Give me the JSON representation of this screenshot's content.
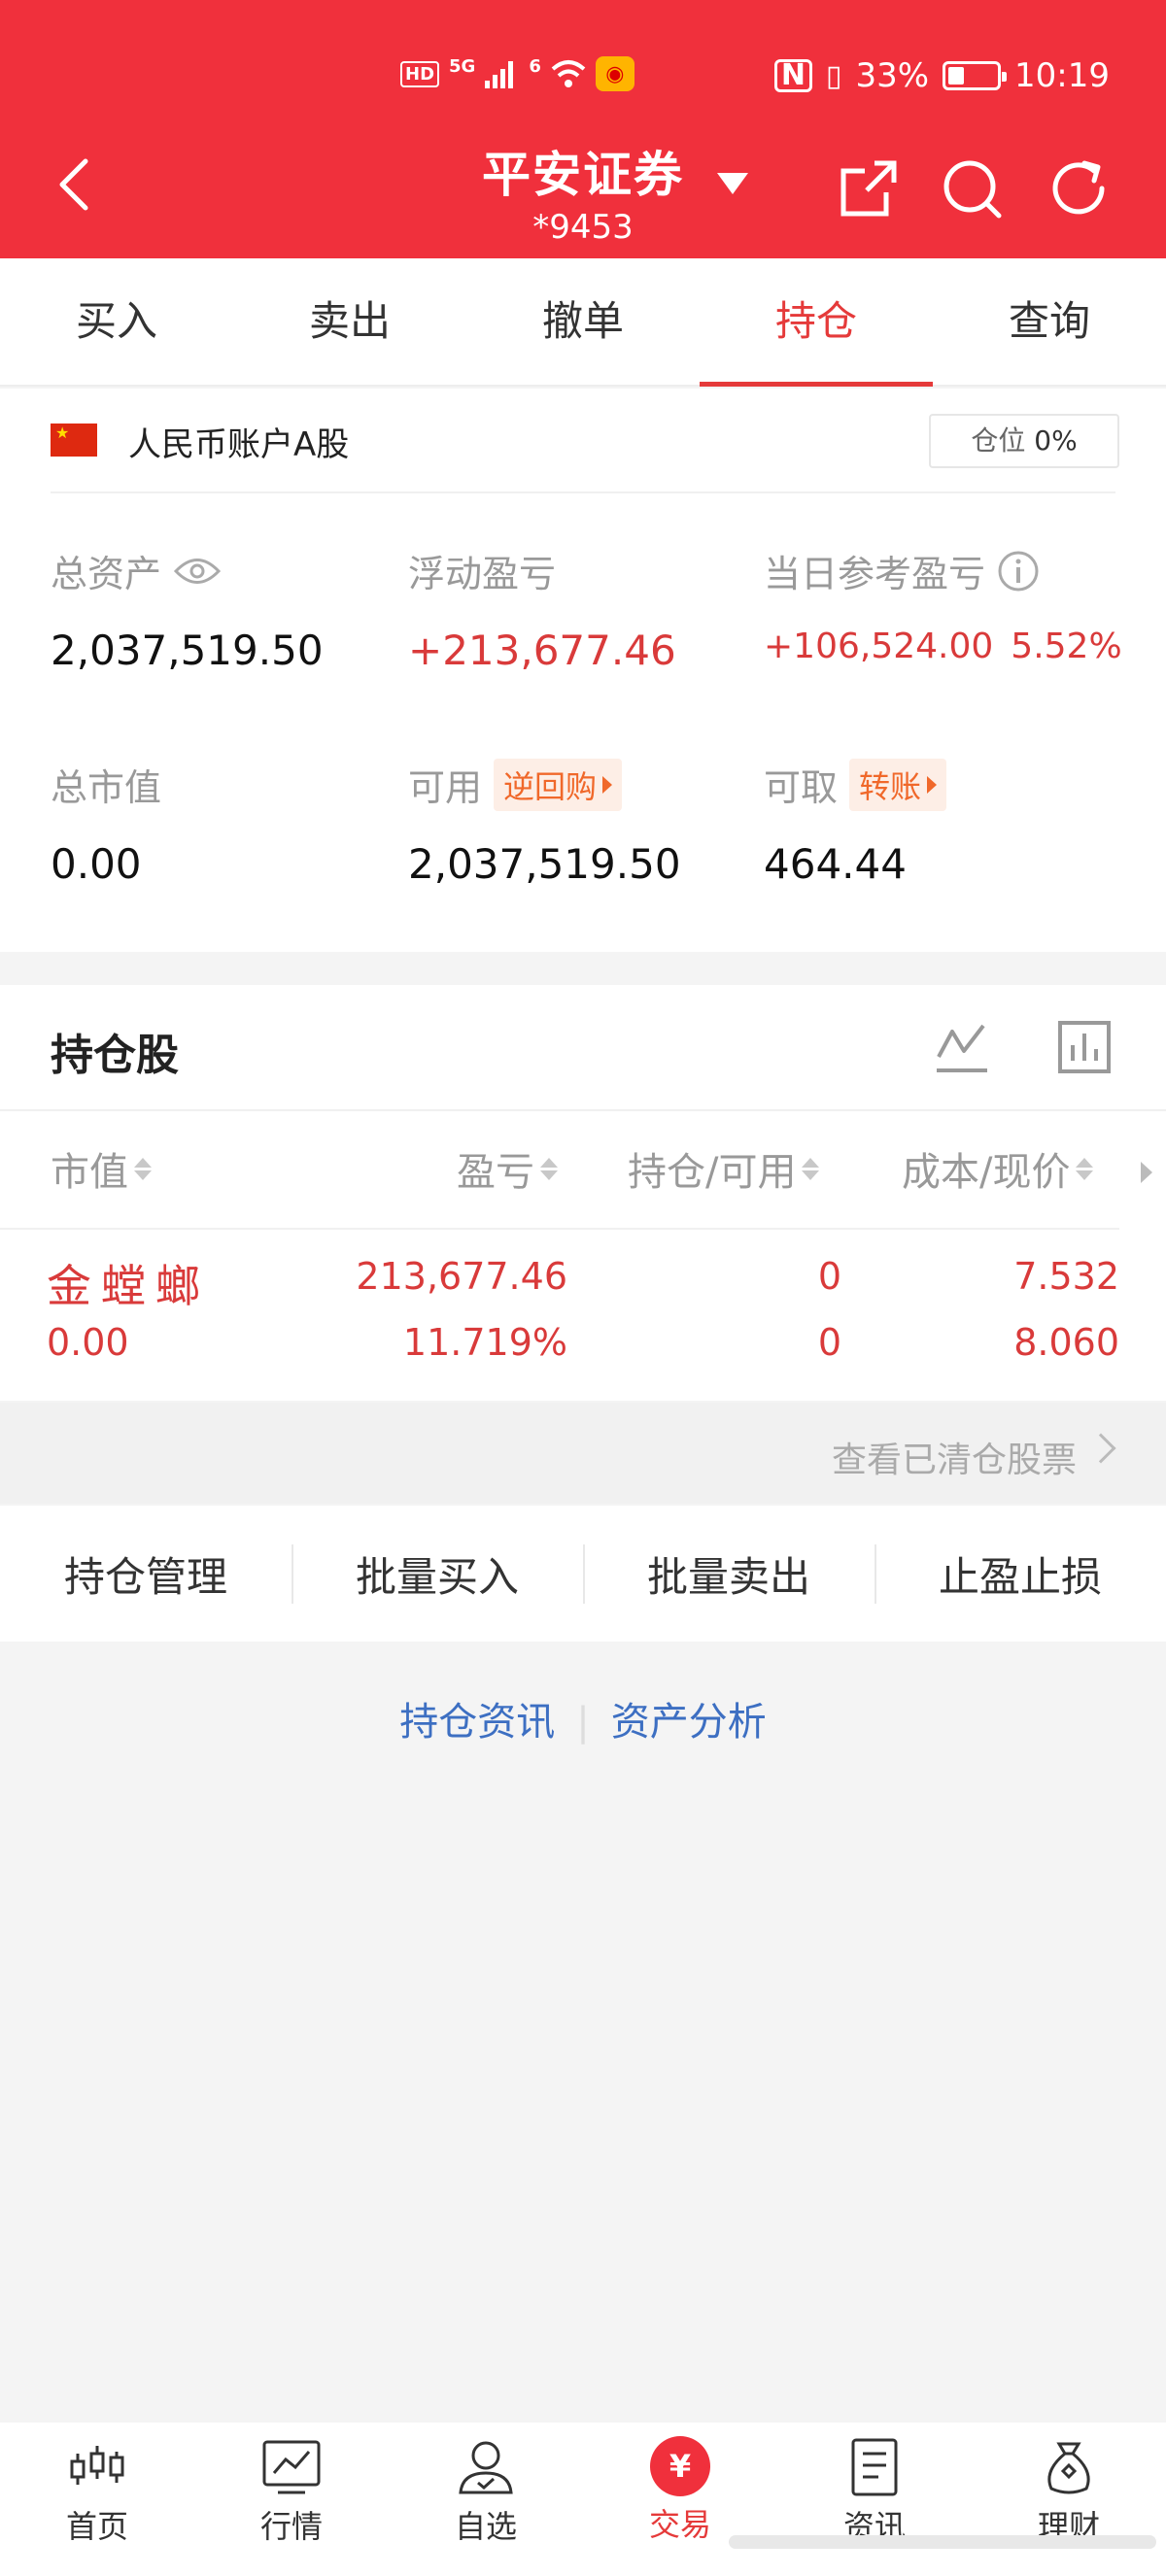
{
  "status_bar": {
    "hd": "HD",
    "net1": "5G",
    "net2": "6",
    "battery_pct": "33%",
    "battery_level": 0.33,
    "time": "10:19"
  },
  "header": {
    "title": "平安证券",
    "account": "*9453",
    "bg_color": "#f0303c"
  },
  "tabs": [
    {
      "label": "买入"
    },
    {
      "label": "卖出"
    },
    {
      "label": "撤单"
    },
    {
      "label": "持仓",
      "active": true
    },
    {
      "label": "查询"
    }
  ],
  "account": {
    "name": "人民币账户A股",
    "position_label": "仓位",
    "position_value": "0%"
  },
  "metrics": {
    "total_assets": {
      "label": "总资产",
      "value": "2,037,519.50"
    },
    "floating_pl": {
      "label": "浮动盈亏",
      "value": "+213,677.46"
    },
    "daily_pl": {
      "label": "当日参考盈亏",
      "value": "+106,524.00",
      "pct": "5.52%"
    },
    "market_value": {
      "label": "总市值",
      "value": "0.00"
    },
    "available": {
      "label": "可用",
      "chip": "逆回购",
      "value": "2,037,519.50"
    },
    "withdrawable": {
      "label": "可取",
      "chip": "转账",
      "value": "464.44"
    }
  },
  "holdings": {
    "title": "持仓股",
    "columns": [
      "市值",
      "盈亏",
      "持仓/可用",
      "成本/现价"
    ],
    "rows": [
      {
        "name": "金螳螂",
        "market_value": "0.00",
        "pl": "213,677.46",
        "pl_pct": "11.719%",
        "position": "0",
        "available": "0",
        "cost": "7.532",
        "price": "8.060"
      }
    ]
  },
  "cleared_link": "查看已清仓股票",
  "actions": [
    "持仓管理",
    "批量买入",
    "批量卖出",
    "止盈止损"
  ],
  "links": [
    "持仓资讯",
    "资产分析"
  ],
  "nav": [
    {
      "label": "首页",
      "icon": "candlestick-icon"
    },
    {
      "label": "行情",
      "icon": "market-chart-icon"
    },
    {
      "label": "自选",
      "icon": "user-favorite-icon"
    },
    {
      "label": "交易",
      "icon": "yen-icon",
      "active": true
    },
    {
      "label": "资讯",
      "icon": "news-document-icon"
    },
    {
      "label": "理财",
      "icon": "money-bag-icon"
    }
  ]
}
